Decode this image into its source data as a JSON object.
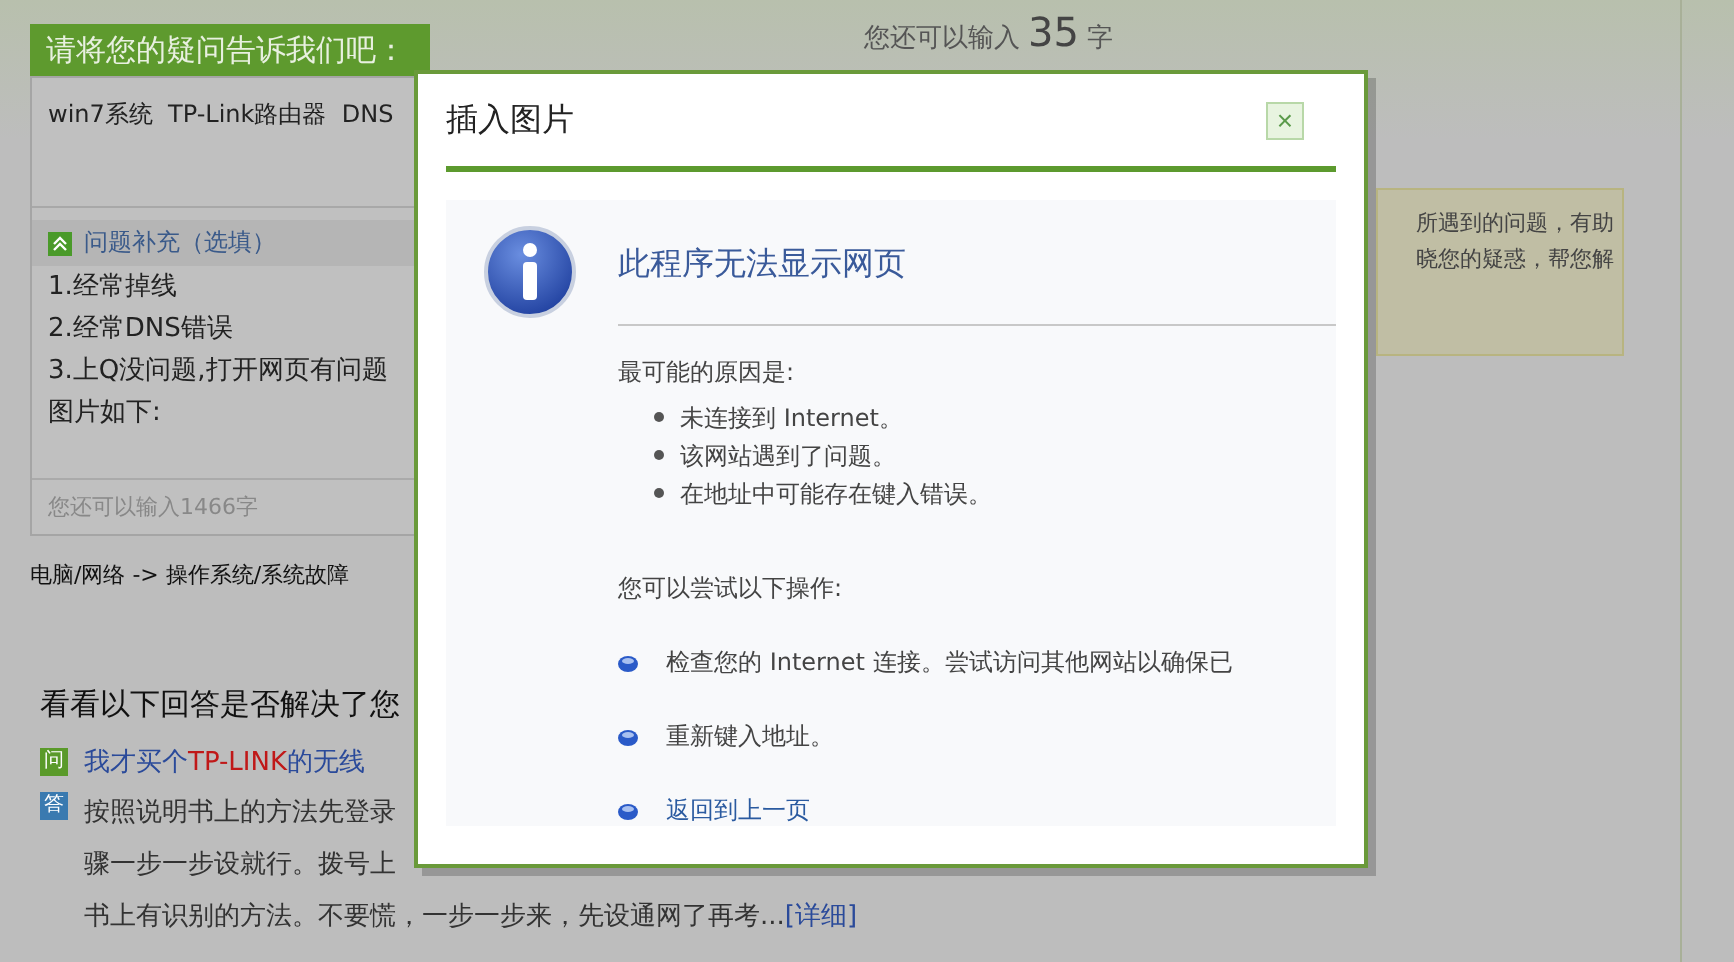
{
  "question_panel": {
    "header": "请将您的疑问告诉我们吧：",
    "title_value": "win7系统  TP-Link路由器  DNS",
    "supplement_label": "问题补充（选填）",
    "supplement_expanded": true,
    "supplement_lines": [
      "1.经常掉线",
      "2.经常DNS错误",
      "3.上Q没问题,打开网页有问题",
      "图片如下:"
    ],
    "remaining": "您还可以输入1466字"
  },
  "title_counter": {
    "prefix": "您还可以输入",
    "count": "35",
    "suffix": "字"
  },
  "category": "电脑/网络 -> 操作系统/系统故障",
  "tip_lines": [
    "所遇到的问题，有助",
    "晓您的疑惑，帮您解"
  ],
  "answers_heading": "看看以下回答是否解决了您",
  "question_item": {
    "badge": "问",
    "segments": [
      {
        "kind": "plain",
        "text": "我才买个"
      },
      {
        "kind": "highlight",
        "text": "TP-LINK"
      },
      {
        "kind": "plain",
        "text": "的无线"
      }
    ]
  },
  "answer_item": {
    "badge": "答",
    "lines": [
      "按照说明书上的方法先登录",
      "骤一步一步设就行。拨号上",
      "书上有识别的方法。不要慌，一步一步来，先设通网了再考..."
    ],
    "link": "[详细]"
  },
  "dialog": {
    "title": "插入图片",
    "close": "×",
    "heading": "此程序无法显示网页",
    "causes_label": "最可能的原因是:",
    "causes": [
      "未连接到 Internet。",
      "该网站遇到了问题。",
      "在地址中可能存在键入错误。"
    ],
    "actions_label": "您可以尝试以下操作:",
    "actions": [
      {
        "kind": "text",
        "text": "检查您的 Internet 连接。尝试访问其他网站以确保已"
      },
      {
        "kind": "text",
        "text": "重新键入地址。"
      },
      {
        "kind": "link",
        "text": "返回到上一页"
      }
    ]
  }
}
